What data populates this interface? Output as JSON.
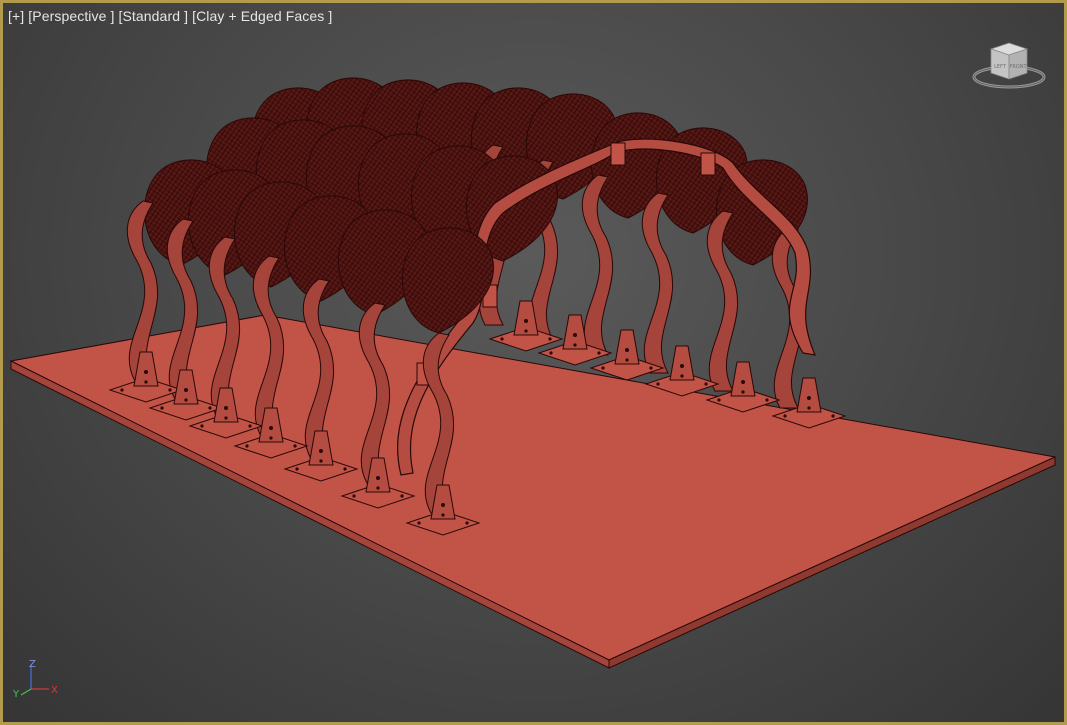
{
  "viewport": {
    "labels": [
      "[+]",
      "[Perspective ]",
      "[Standard ]",
      "[Clay + Edged Faces ]"
    ],
    "border_color": "#b39b4e",
    "background_color": "#4a4a4a"
  },
  "scene": {
    "object": "parametric-arch-pavilion",
    "material_color": "#c25447",
    "dark_material_color": "#5a1412"
  },
  "viewcube": {
    "icon": "viewcube-icon",
    "face_labels": [
      "LEFT",
      "FRONT"
    ]
  },
  "axis_gizmo": {
    "labels": [
      "Z",
      "Y",
      "X"
    ],
    "colors": {
      "x": "#d23a3a",
      "y": "#4cbf4c",
      "z": "#4a6ee0"
    }
  }
}
